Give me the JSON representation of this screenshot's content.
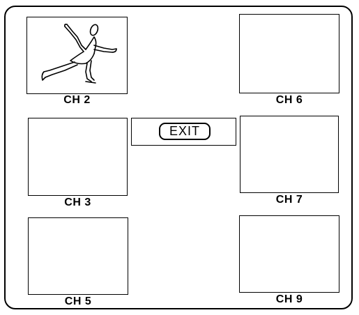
{
  "channels": [
    {
      "label": "CH 2",
      "icon": "figure-skater-icon",
      "has_image": true
    },
    {
      "label": "CH 6",
      "has_image": false
    },
    {
      "label": "CH 3",
      "has_image": false
    },
    {
      "label": "CH 7",
      "has_image": false
    },
    {
      "label": "CH 5",
      "has_image": false
    },
    {
      "label": "CH 9",
      "has_image": false
    }
  ],
  "exit_label": "EXIT"
}
